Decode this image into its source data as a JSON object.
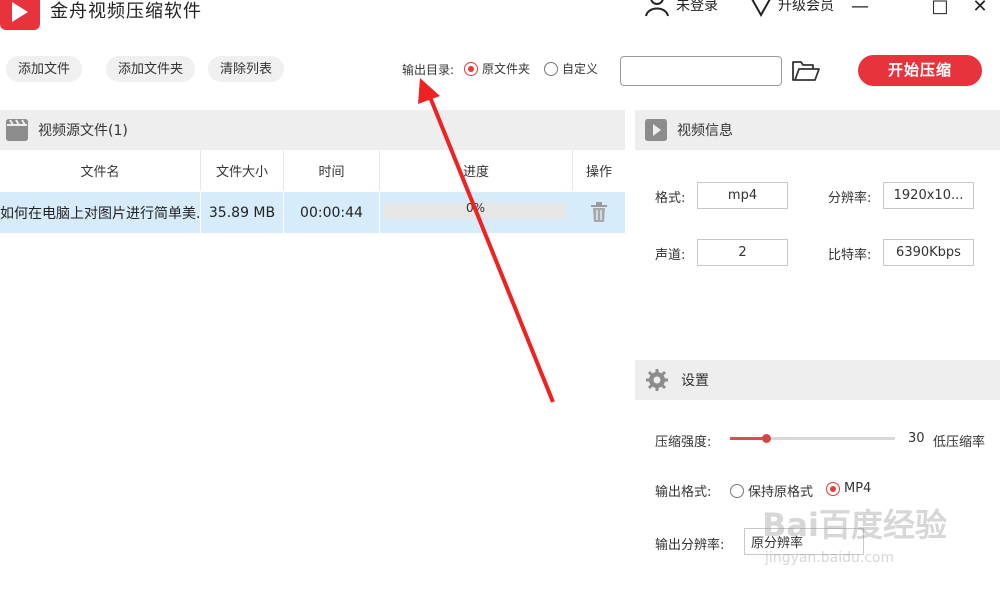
{
  "app": {
    "title": "金舟视频压缩软件"
  },
  "header": {
    "login_label": "未登录",
    "upgrade_label": "升级会员",
    "minimize": "—",
    "maximize": "□",
    "close": "✕"
  },
  "toolbar": {
    "add_file": "添加文件",
    "add_folder": "添加文件夹",
    "clear_list": "清除列表",
    "output_dir_label": "输出目录:",
    "radio_source_folder": "原文件夹",
    "radio_custom": "自定义",
    "output_path_value": "",
    "start_button": "开始压缩"
  },
  "source_panel": {
    "title": "视频源文件(1)",
    "columns": [
      "文件名",
      "文件大小",
      "时间",
      "进度",
      "操作"
    ],
    "rows": [
      {
        "name": "如何在电脑上对图片进行简单美...",
        "size": "35.89 MB",
        "duration": "00:00:44",
        "progress_text": "0%",
        "progress": 0
      }
    ]
  },
  "video_info": {
    "title": "视频信息",
    "format_label": "格式:",
    "format_value": "mp4",
    "resolution_label": "分辨率:",
    "resolution_value": "1920x10...",
    "channel_label": "声道:",
    "channel_value": "2",
    "bitrate_label": "比特率:",
    "bitrate_value": "6390Kbps"
  },
  "settings": {
    "title": "设置",
    "strength_label": "压缩强度:",
    "strength_value": "30",
    "strength_level": 0.22,
    "strength_hint": "低压缩率",
    "output_format_label": "输出格式:",
    "format_keep": "保持原格式",
    "format_mp4": "MP4",
    "output_resolution_label": "输出分辨率:",
    "output_resolution_value": "原分辨率"
  },
  "colors": {
    "accent": "#e8323c",
    "row_selected": "#d7ecfb",
    "panel_header": "#eeeeee"
  },
  "watermark": {
    "text": "Bai百度经验",
    "sub": "jingyan.baidu.com"
  }
}
